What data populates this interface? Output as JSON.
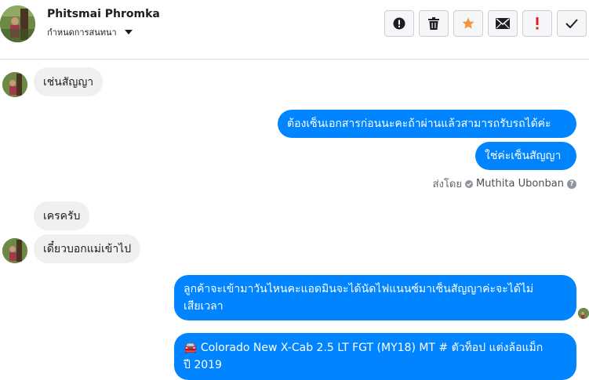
{
  "header": {
    "contact_name": "Phitsmai Phromka",
    "subtitle": "กำหนดการสนทนา",
    "actions": [
      {
        "icon": "alert-circle-icon"
      },
      {
        "icon": "trash-icon"
      },
      {
        "icon": "star-icon"
      },
      {
        "icon": "envelope-icon"
      },
      {
        "icon": "exclamation-icon"
      },
      {
        "icon": "check-icon"
      }
    ]
  },
  "messages": [
    {
      "side": "in",
      "text": "เช่นสัญญา"
    },
    {
      "side": "out",
      "text": "ต้องเซ็นเอกสารก่อนนะคะถ้าผ่านแล้วสามารถรับรถได้ค่ะ"
    },
    {
      "side": "out",
      "text": "ใช่ค่ะเซ็นสัญญา"
    },
    {
      "side": "in",
      "text": "เครครับ"
    },
    {
      "side": "in",
      "text": "เดี๋ยวบอกแม่เข้าไป"
    },
    {
      "side": "out",
      "line1": "ลูกค้าจะเข้ามาวันไหนคะแอดมินจะได้นัดไฟแนนซ์มาเซ็นสัญญาค่ะจะได้ไม่",
      "line2": "เสียเวลา"
    },
    {
      "side": "out",
      "line1": "🚘 Colorado New X-Cab 2.5 LT FGT (MY18) MT # ตัวท็อป แต่งล้อแม็ก",
      "line2": "ปี 2019"
    }
  ],
  "sent_by": {
    "prefix": "ส่งโดย",
    "agent": "Muthita Ubonban",
    "help": "?"
  },
  "colors": {
    "outgoing": "#0084ff",
    "incoming": "#f1f0f0",
    "accent_star": "#f7923b",
    "alert_red": "#e02020"
  }
}
